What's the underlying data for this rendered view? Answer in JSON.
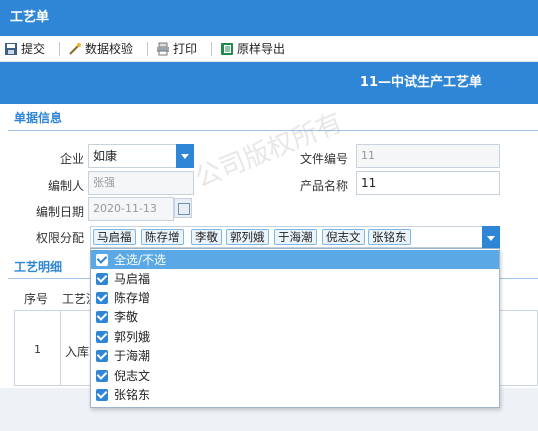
{
  "window": {
    "title": "工艺单"
  },
  "toolbar": {
    "items": [
      {
        "label": "提交",
        "icon": "save-icon"
      },
      {
        "label": "数据校验",
        "icon": "wand-icon"
      },
      {
        "label": "打印",
        "icon": "printer-icon"
      },
      {
        "label": "原样导出",
        "icon": "excel-icon"
      }
    ]
  },
  "header": {
    "doc_title": "11—中试生产工艺单"
  },
  "form": {
    "section_title": "单据信息",
    "company_label": "企业",
    "company_value": "如康",
    "doc_no_label": "文件编号",
    "doc_no_value": "11",
    "editor_label": "编制人",
    "editor_value": "张强",
    "product_label": "产品名称",
    "product_value": "11",
    "date_label": "编制日期",
    "date_value": "2020-11-13",
    "perm_label": "权限分配",
    "perm_selected": [
      "马启福",
      "陈存增",
      "李敬",
      "郭列娥",
      "于海潮",
      "倪志文",
      "张铭东"
    ]
  },
  "detail": {
    "section_title": "工艺明细",
    "col_seq": "序号",
    "col_proc": "工艺流",
    "row_seq": "1",
    "row_text": "入库"
  },
  "dropdown": {
    "options": [
      {
        "label": "全选/不选",
        "checked": true,
        "highlighted": true
      },
      {
        "label": "马启福",
        "checked": true
      },
      {
        "label": "陈存增",
        "checked": true
      },
      {
        "label": "李敬",
        "checked": true
      },
      {
        "label": "郭列娥",
        "checked": true
      },
      {
        "label": "于海潮",
        "checked": true
      },
      {
        "label": "倪志文",
        "checked": true
      },
      {
        "label": "张铭东",
        "checked": true
      }
    ]
  },
  "watermark": {
    "text": "公司版权所有"
  },
  "colors": {
    "accent": "#2f86d6",
    "highlight": "#5aa9e6"
  }
}
